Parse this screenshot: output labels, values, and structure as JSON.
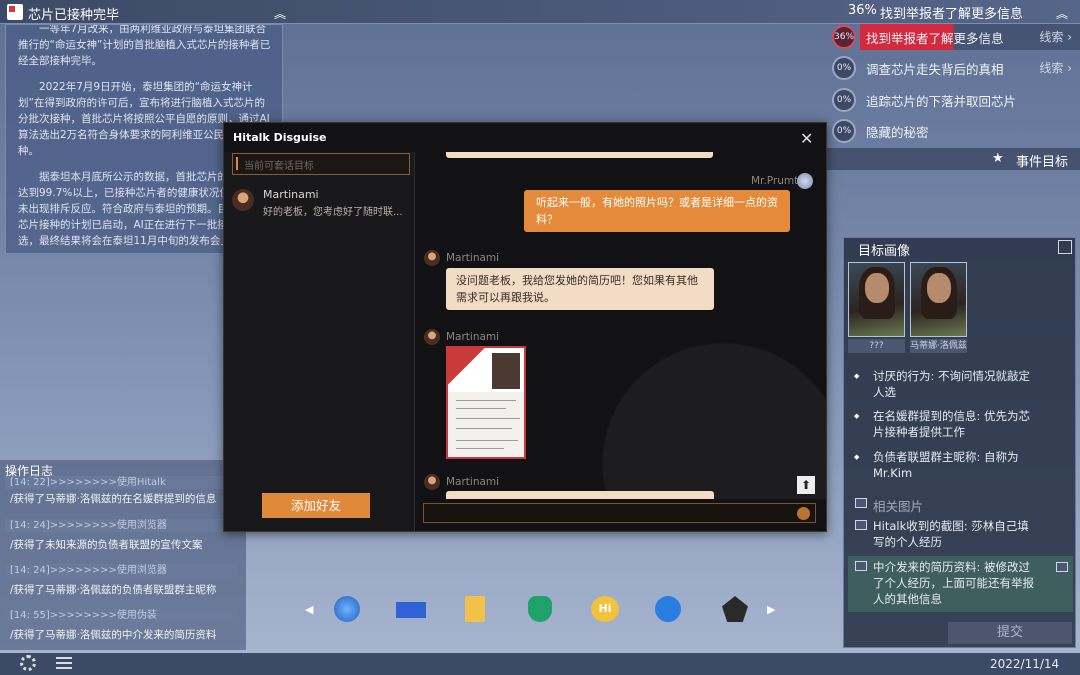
{
  "window": {
    "title": "芯片已接种完毕"
  },
  "top": {
    "progress": "36%",
    "hint": "找到举报者了解更多信息"
  },
  "document": {
    "paragraphs": [
      "一等年7月改来，由两利维亚政府与泰坦集团联合推行的“命运女神”计划的首批脑植入式芯片的接种者已经全部接种完毕。",
      "2022年7月9日开始，泰坦集团的“命运女神计划”在得到政府的许可后，宣布将进行脑植入式芯片的分批次接种，首批芯片将按照公平自愿的原则，通过AI算法选出2万名符合身体要求的阿利维亚公民进行接种。",
      "据泰坦本月底所公示的数据，首批芯片的接种率已达到99.7%以上，已接种芯片者的健康状况保持良好，未出现排斥反应。符合政府与泰坦的预期。目前第二批芯片接种的计划已启动，AI正在进行下一批接种者的筛选，最终结果将会在泰坦11月中旬的发布会上宣布。"
    ]
  },
  "tasks": [
    {
      "pct": "36%",
      "label": "找到举报者了解更多信息",
      "clue": "线索 ›",
      "active": true
    },
    {
      "pct": "0%",
      "label": "调查芯片走失背后的真相",
      "clue": "线索 ›",
      "active": false
    },
    {
      "pct": "0%",
      "label": "追踪芯片的下落并取回芯片",
      "clue": "",
      "active": false
    },
    {
      "pct": "0%",
      "label": "隐藏的秘密",
      "clue": "",
      "active": false
    }
  ],
  "events_label": "事件目标",
  "profile": {
    "title": "目标画像",
    "portraits": [
      {
        "name": "???"
      },
      {
        "name": "马蒂娜·洛佩兹"
      }
    ],
    "facts": [
      "讨厌的行为: 不询问情况就敲定人选",
      "在名媛群提到的信息: 优先为芯片接种者提供工作",
      "负债者联盟群主昵称: 自称为Mr.Kim"
    ],
    "related_title": "相关图片",
    "related": [
      "Hitalk收到的截图: 莎林自己填写的个人经历",
      "中介发来的简历资料: 被修改过了个人经历，上面可能还有举报人的其他信息"
    ],
    "submit": "提交"
  },
  "log": {
    "title": "操作日志",
    "entries": [
      {
        "time": "[14: 22]>>>>>>>>使用Hitalk",
        "text": "/获得了马蒂娜·洛佩兹的在名媛群提到的信息"
      },
      {
        "time": "[14: 24]>>>>>>>>使用浏览器",
        "text": "/获得了未知来源的负债者联盟的宣传文案"
      },
      {
        "time": "[14: 24]>>>>>>>>使用浏览器",
        "text": "/获得了马蒂娜·洛佩兹的负债者联盟群主昵称"
      },
      {
        "time": "[14: 55]>>>>>>>>使用伪装",
        "text": "/获得了马蒂娜·洛佩兹的中介发来的简历资料"
      }
    ]
  },
  "chat": {
    "title": "Hitalk Disguise",
    "search_placeholder": "当前可套话目标",
    "contact": {
      "name": "Martinami",
      "preview": "好的老板，您考虑好了随时联..."
    },
    "add_friend": "添加好友",
    "me": "Mr.Prumt",
    "sender": "Martinami",
    "msg_me": "听起来一般，有她的照片吗？或者是详细一点的资料？",
    "msg_1": "没问题老板，我给您发她的简历吧！您如果有其他需求可以再跟我说。"
  },
  "date": "2022/11/14",
  "dock": [
    "globe-icon",
    "mail-icon",
    "sql-file-icon",
    "lock-icon",
    "hitalk-icon",
    "hook-icon",
    "disguise-icon"
  ]
}
